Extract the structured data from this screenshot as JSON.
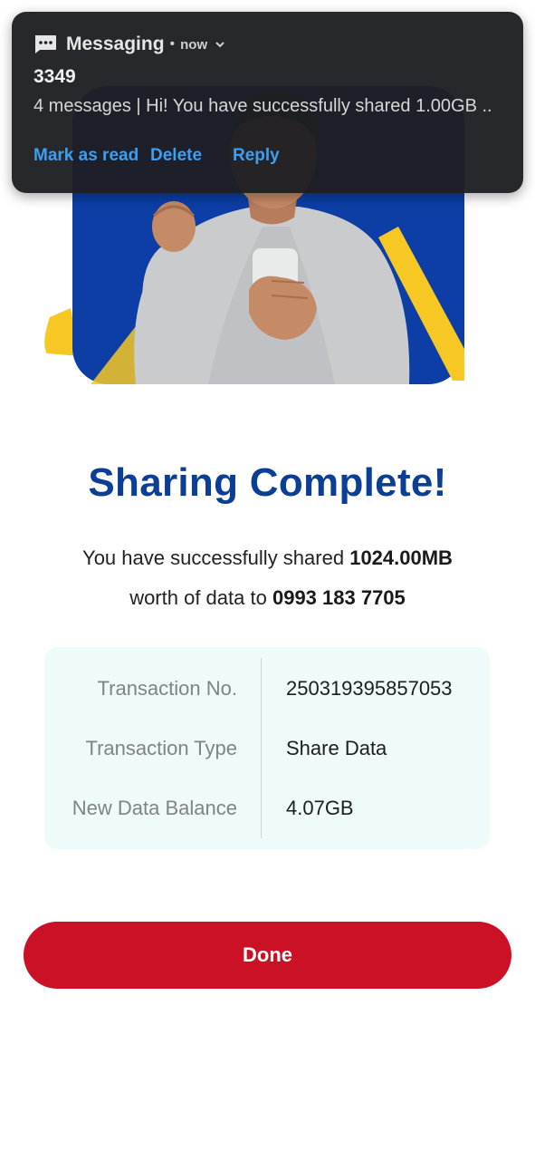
{
  "notification": {
    "app_name": "Messaging",
    "separator": "•",
    "time": "now",
    "sender": "3349",
    "body": "4 messages | Hi! You have successfully shared 1.00GB ..",
    "actions": {
      "mark_as_read": "Mark as read",
      "delete": "Delete",
      "reply": "Reply"
    },
    "icons": {
      "app": "message-bubble-icon",
      "expand": "chevron-down-icon"
    }
  },
  "hero": {
    "description_icon": "celebrating-man-with-phone-illustration"
  },
  "main": {
    "title": "Sharing Complete!",
    "message_prefix": "You have successfully shared",
    "amount": "1024.00MB",
    "message_middle": "worth of data to",
    "recipient": "0993 183 7705"
  },
  "details": {
    "rows": [
      {
        "label": "Transaction No.",
        "value": "250319395857053"
      },
      {
        "label": "Transaction Type",
        "value": "Share Data"
      },
      {
        "label": "New Data Balance",
        "value": "4.07GB"
      }
    ]
  },
  "done_button": {
    "label": "Done"
  },
  "colors": {
    "title": "#0a3f95",
    "button": "#cb1126",
    "link": "#3d9ef2",
    "panel": "#effafb",
    "hero_blue": "#0c3ea6",
    "hero_yellow": "#f7c823"
  }
}
